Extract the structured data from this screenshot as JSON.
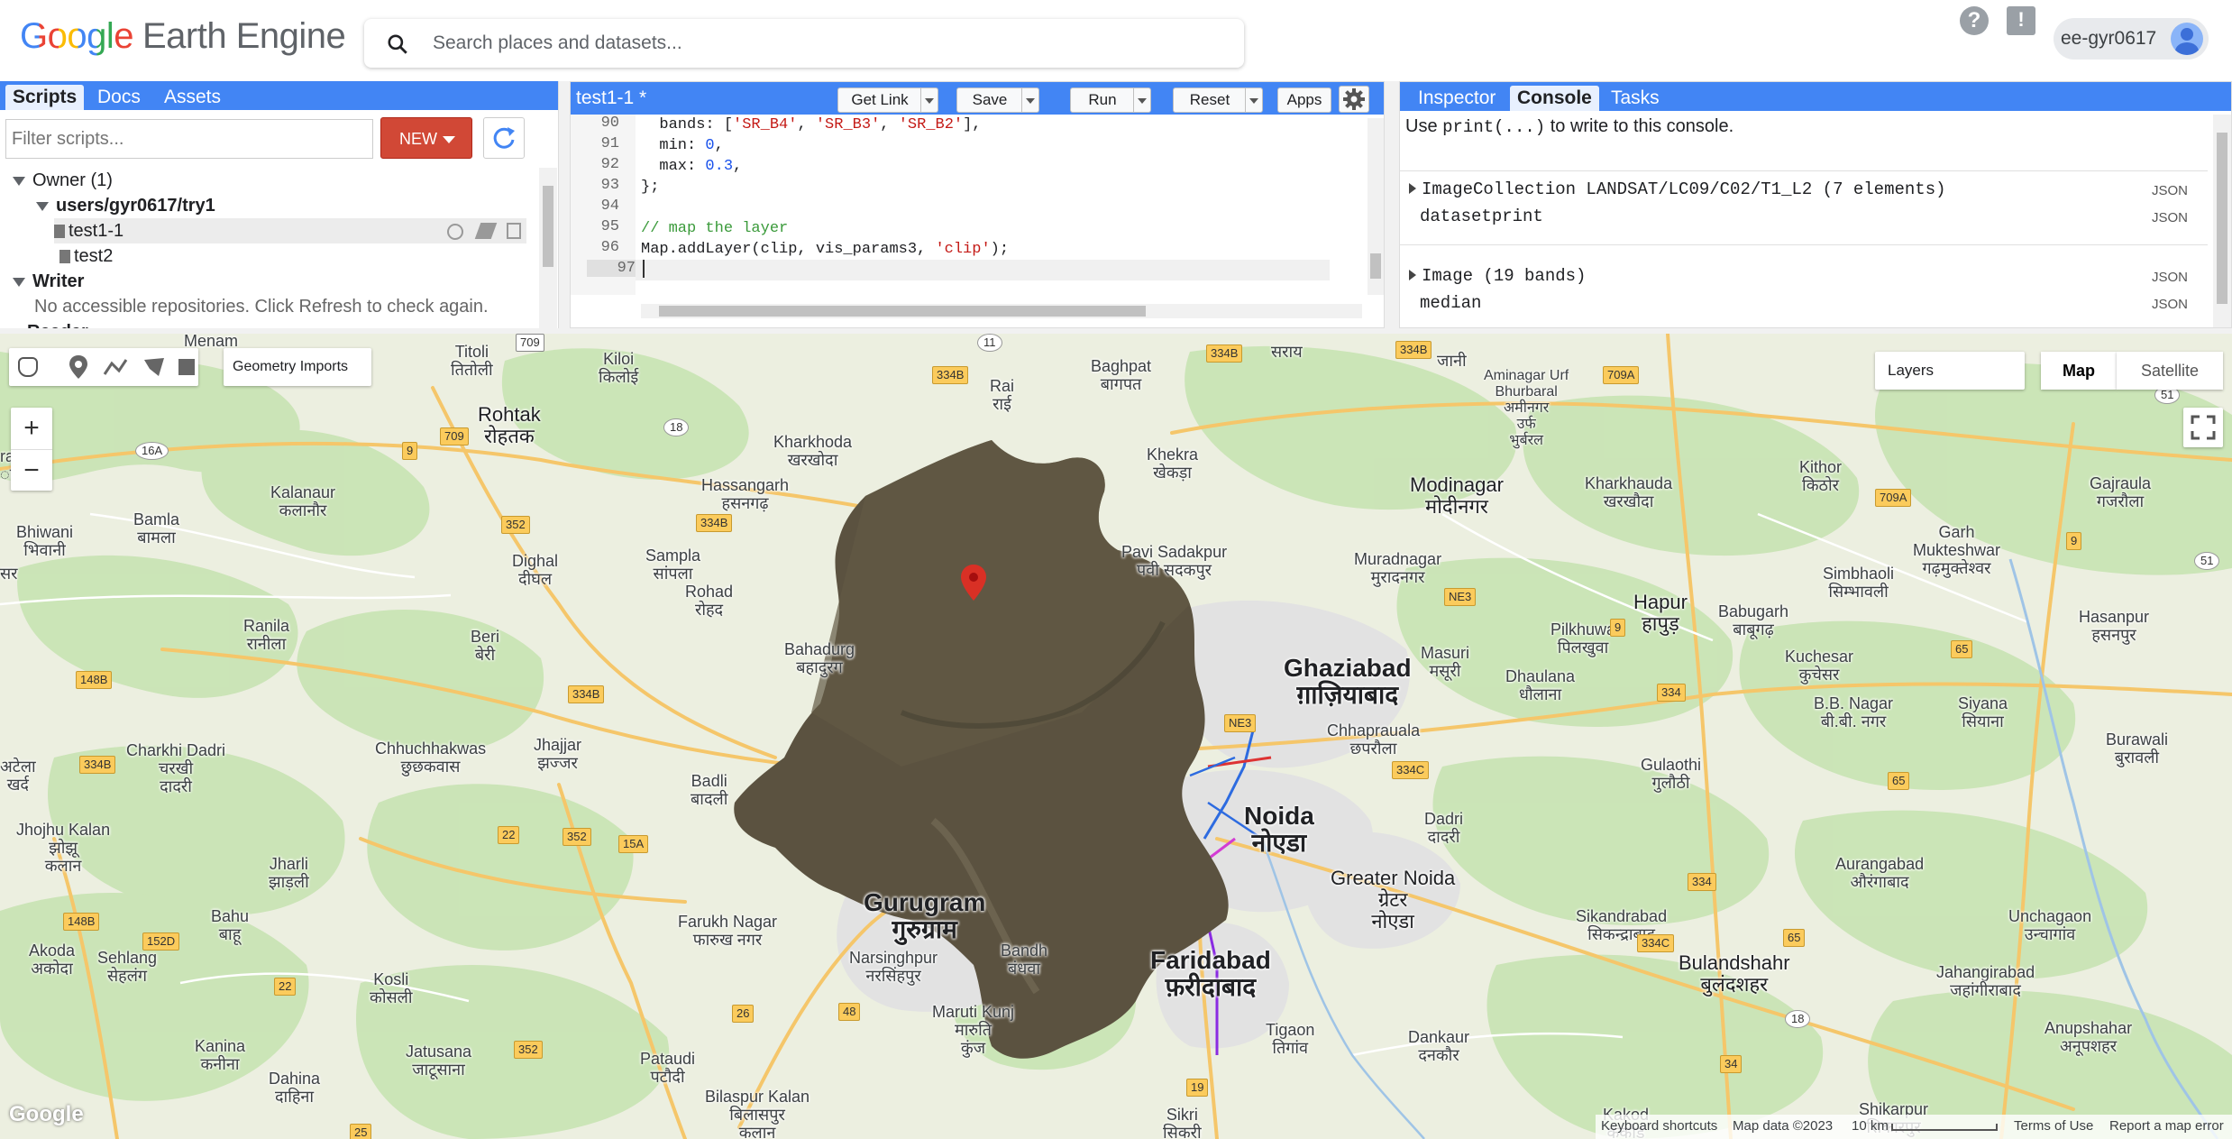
{
  "app": {
    "logo_google": "Google",
    "logo_rest": "Earth Engine",
    "search_placeholder": "Search places and datasets...",
    "user": "ee-gyr0617"
  },
  "left_panel": {
    "tabs": [
      "Scripts",
      "Docs",
      "Assets"
    ],
    "filter_placeholder": "Filter scripts...",
    "new_label": "NEW",
    "tree": {
      "owner": "Owner (1)",
      "repo": "users/gyr0617/try1",
      "files": [
        "test1-1",
        "test2"
      ],
      "writer": "Writer",
      "writer_msg": "No accessible repositories. Click Refresh to check again.",
      "reader_partial": "Reader"
    }
  },
  "editor": {
    "file_title": "test1-1 *",
    "buttons": [
      "Get Link",
      "Save",
      "Run",
      "Reset",
      "Apps"
    ],
    "line_numbers": [
      "90",
      "91",
      "92",
      "93",
      "94",
      "95",
      "96",
      "97"
    ],
    "lines": {
      "l90_pre": "  bands: [",
      "l90_s1": "'SR_B4'",
      "l90_c1": ", ",
      "l90_s2": "'SR_B3'",
      "l90_c2": ", ",
      "l90_s3": "'SR_B2'",
      "l90_post": "],",
      "l91_pre": "  min: ",
      "l91_num": "0",
      "l91_post": ",",
      "l92_pre": "  max: ",
      "l92_num": "0.3",
      "l92_post": ",",
      "l93": "};",
      "l95": "// map the layer",
      "l96_pre": "Map.addLayer(clip, vis_params3, ",
      "l96_str": "'clip'",
      "l96_post": ");"
    }
  },
  "console_panel": {
    "tabs": [
      "Inspector",
      "Console",
      "Tasks"
    ],
    "hint_pre": "Use ",
    "hint_code": "print(...)",
    "hint_post": " to write to this console.",
    "entries": [
      {
        "label": "ImageCollection LANDSAT/LC09/C02/T1_L2 (7 elements)",
        "json": "JSON"
      },
      {
        "label": "datasetprint",
        "json": "JSON"
      },
      {
        "label": "Image (19 bands)",
        "json": "JSON"
      },
      {
        "label": "median",
        "json": "JSON"
      }
    ]
  },
  "map": {
    "geometry_imports": "Geometry Imports",
    "layers": "Layers",
    "map_type": [
      "Map",
      "Satellite"
    ],
    "zoom_in": "+",
    "zoom_out": "−",
    "labels": [
      {
        "id": "menam",
        "text": "Menam"
      },
      {
        "id": "titoli",
        "text": "Titoli\nतितोली"
      },
      {
        "id": "kiloi",
        "text": "Kiloi\nकिलोई"
      },
      {
        "id": "rai",
        "text": "Rai\nराई"
      },
      {
        "id": "baghpat",
        "text": "Baghpat\nबागपत"
      },
      {
        "id": "sarai",
        "text": "सराय"
      },
      {
        "id": "jani",
        "text": "जानी"
      },
      {
        "id": "aminagar",
        "text": "Aminagar Urf\nBhurbaral\nअमीनगर\nउर्फ\nभुर्बरल"
      },
      {
        "id": "rohtak",
        "text": "Rohtak\nरोहतक"
      },
      {
        "id": "kharkhoda",
        "text": "Kharkhoda\nखरखोदा"
      },
      {
        "id": "khekra",
        "text": "Khekra\nखेकड़ा"
      },
      {
        "id": "kithor",
        "text": "Kithor\nकिठोर"
      },
      {
        "id": "gajraula",
        "text": "Gajraula\nगजरौला"
      },
      {
        "id": "hassangarh",
        "text": "Hassangarh\nहसनगढ़"
      },
      {
        "id": "kalanaur",
        "text": "Kalanaur\nकलानौर"
      },
      {
        "id": "modinagar",
        "text": "Modinagar\nमोदीनगर"
      },
      {
        "id": "kharkhauda2",
        "text": "Kharkhauda\nखरखौदा"
      },
      {
        "id": "bamla",
        "text": "Bamla\nबामला"
      },
      {
        "id": "bhiwani",
        "text": "Bhiwani\nभिवानी"
      },
      {
        "id": "sampla",
        "text": "Sampla\nसांपला"
      },
      {
        "id": "dighal",
        "text": "Dighal\nदीघल"
      },
      {
        "id": "pavi",
        "text": "Pavi Sadakpur\nपवी सदकपुर"
      },
      {
        "id": "muradnagar",
        "text": "Muradnagar\nमुरादनगर"
      },
      {
        "id": "garh",
        "text": "Garh\nMukteshwar\nगढ़मुक्तेश्वर"
      },
      {
        "id": "rohad",
        "text": "Rohad\nरोहद"
      },
      {
        "id": "hapur",
        "text": "Hapur\nहापुड़"
      },
      {
        "id": "simbhaoli",
        "text": "Simbhaoli\nसिम्भावली"
      },
      {
        "id": "hasanpur",
        "text": "Hasanpur\nहसनपुर"
      },
      {
        "id": "ranila",
        "text": "Ranila\nरानीला"
      },
      {
        "id": "beri",
        "text": "Beri\nबेरी"
      },
      {
        "id": "pilkhuwa",
        "text": "Pilkhuwa\nपिलखुवा"
      },
      {
        "id": "babugarh",
        "text": "Babugarh\nबाबूगढ़"
      },
      {
        "id": "bahadurgarh",
        "text": "Bahadurg\nबहादुरग"
      },
      {
        "id": "masuri",
        "text": "Masuri\nमसूरी"
      },
      {
        "id": "kuchesar",
        "text": "Kuchesar\nकुचेसर"
      },
      {
        "id": "ghaziabad",
        "text": "Ghaziabad\nग़ाज़ियाबाद"
      },
      {
        "id": "dhaulana",
        "text": "Dhaulana\nधौलाना"
      },
      {
        "id": "bbnagar",
        "text": "B.B. Nagar\nबी.बी. नगर"
      },
      {
        "id": "siyana",
        "text": "Siyana\nसियाना"
      },
      {
        "id": "chhuchhakwas",
        "text": "Chhuchhakwas\nछुछकवास"
      },
      {
        "id": "jhajjar",
        "text": "Jhajjar\nझज्जर"
      },
      {
        "id": "charkhi",
        "text": "Charkhi Dadri\nचरखी\nदादरी"
      },
      {
        "id": "chhaprauala",
        "text": "Chhaprauala\nछपरौला"
      },
      {
        "id": "gulaothi",
        "text": "Gulaothi\nगुलौठी"
      },
      {
        "id": "burawali",
        "text": "Burawali\nबुरावली"
      },
      {
        "id": "atela",
        "text": "अटेला\nखर्द"
      },
      {
        "id": "badli",
        "text": "Badli\nबादली"
      },
      {
        "id": "dadri",
        "text": "Dadri\nदादरी"
      },
      {
        "id": "noida",
        "text": "Noida\nनोएडा"
      },
      {
        "id": "jhojhu",
        "text": "Jhojhu Kalan\nझोझू\nकलान"
      },
      {
        "id": "jharli",
        "text": "Jharli\nझाड़ली"
      },
      {
        "id": "gurugram",
        "text": "Gurugram\nगुरुग्राम"
      },
      {
        "id": "greaternoida",
        "text": "Greater Noida\nग्रेटर\nनोएडा"
      },
      {
        "id": "aurangabad",
        "text": "Aurangabad\nऔरंगाबाद"
      },
      {
        "id": "unchagaon",
        "text": "Unchagaon\nउन्चागांव"
      },
      {
        "id": "bahu",
        "text": "Bahu\nबाहू"
      },
      {
        "id": "farukh",
        "text": "Farukh Nagar\nफारुख नगर"
      },
      {
        "id": "sikandrabad",
        "text": "Sikandrabad\nसिकन्द्राबाद"
      },
      {
        "id": "akoda",
        "text": "Akoda\nअकोदा"
      },
      {
        "id": "sehlang",
        "text": "Sehlang\nसेहलंग"
      },
      {
        "id": "narsinghpur",
        "text": "Narsinghpur\nनरसिंहपुर"
      },
      {
        "id": "bandh",
        "text": "Bandh\nबंधवा"
      },
      {
        "id": "faridabad",
        "text": "Faridabad\nफ़रीदाबाद"
      },
      {
        "id": "bulandshahr",
        "text": "Bulandshahr\nबुलंदशहर"
      },
      {
        "id": "jahangirabad",
        "text": "Jahangirabad\nजहांगीराबाद"
      },
      {
        "id": "kosli",
        "text": "Kosli\nकोसली"
      },
      {
        "id": "maruti",
        "text": "Maruti Kunj\nमारुति\nकुंज"
      },
      {
        "id": "tigaon",
        "text": "Tigaon\nतिगांव"
      },
      {
        "id": "dankaur",
        "text": "Dankaur\nदनकौर"
      },
      {
        "id": "anupshahar",
        "text": "Anupshahar\nअनूपशहर"
      },
      {
        "id": "kanina",
        "text": "Kanina\nकनीना"
      },
      {
        "id": "jatusana",
        "text": "Jatusana\nजाटूसाना"
      },
      {
        "id": "pataudi",
        "text": "Pataudi\nपटौदी"
      },
      {
        "id": "dahina",
        "text": "Dahina\nदाहिना"
      },
      {
        "id": "bilaspur",
        "text": "Bilaspur Kalan\nबिलासपुर\nकलान"
      },
      {
        "id": "sikri",
        "text": "Sikri\nसिकरी"
      },
      {
        "id": "kakod",
        "text": "Kakod\nककोड"
      },
      {
        "id": "shikarpur",
        "text": "Shikarpur\nशिकारपुर"
      },
      {
        "id": "jharsar",
        "text": "सर"
      },
      {
        "id": "rana",
        "text": "rana\nाना"
      }
    ],
    "shields": [
      {
        "id": "s709a",
        "text": "709"
      },
      {
        "id": "s11",
        "text": "11"
      },
      {
        "id": "s334b1",
        "text": "334B"
      },
      {
        "id": "s334b2",
        "text": "334B"
      },
      {
        "id": "s334b3",
        "text": "334B"
      },
      {
        "id": "s709a2",
        "text": "709A"
      },
      {
        "id": "s709a3",
        "text": "709A"
      },
      {
        "id": "s18",
        "text": "18"
      },
      {
        "id": "s16a",
        "text": "16A"
      },
      {
        "id": "s9",
        "text": "9"
      },
      {
        "id": "s709b",
        "text": "709"
      },
      {
        "id": "s352a",
        "text": "352"
      },
      {
        "id": "s334b4",
        "text": "334B"
      },
      {
        "id": "s9b",
        "text": "9"
      },
      {
        "id": "s51",
        "text": "51"
      },
      {
        "id": "s51b",
        "text": "51"
      },
      {
        "id": "sne3",
        "text": "NE3"
      },
      {
        "id": "sne3b",
        "text": "NE3"
      },
      {
        "id": "s9c",
        "text": "9"
      },
      {
        "id": "s65",
        "text": "65"
      },
      {
        "id": "s148b",
        "text": "148B"
      },
      {
        "id": "s334b5",
        "text": "334B"
      },
      {
        "id": "s334",
        "text": "334"
      },
      {
        "id": "s334c",
        "text": "334C"
      },
      {
        "id": "s334b6",
        "text": "334B"
      },
      {
        "id": "s65b",
        "text": "65"
      },
      {
        "id": "s22",
        "text": "22"
      },
      {
        "id": "s352b",
        "text": "352"
      },
      {
        "id": "s15a",
        "text": "15A"
      },
      {
        "id": "s334b7",
        "text": "334"
      },
      {
        "id": "s148b2",
        "text": "148B"
      },
      {
        "id": "s152d",
        "text": "152D"
      },
      {
        "id": "s65c",
        "text": "65"
      },
      {
        "id": "s334c2",
        "text": "334C"
      },
      {
        "id": "s22b",
        "text": "22"
      },
      {
        "id": "s26",
        "text": "26"
      },
      {
        "id": "s48",
        "text": "48"
      },
      {
        "id": "s18b",
        "text": "18"
      },
      {
        "id": "s352c",
        "text": "352"
      },
      {
        "id": "s34",
        "text": "34"
      },
      {
        "id": "s19",
        "text": "19"
      },
      {
        "id": "s25",
        "text": "25"
      }
    ],
    "footer": {
      "watermark": "Google",
      "shortcuts": "Keyboard shortcuts",
      "mapdata": "Map data ©2023",
      "scale": "10 km",
      "terms": "Terms of Use",
      "report": "Report a map error"
    },
    "colors": {
      "land": "#ecefe0",
      "green": "#c7e3b5",
      "urban": "#e6e6e6",
      "clip": "#5b5240",
      "road": "#f5c66a",
      "accent": "#4285f4"
    }
  }
}
